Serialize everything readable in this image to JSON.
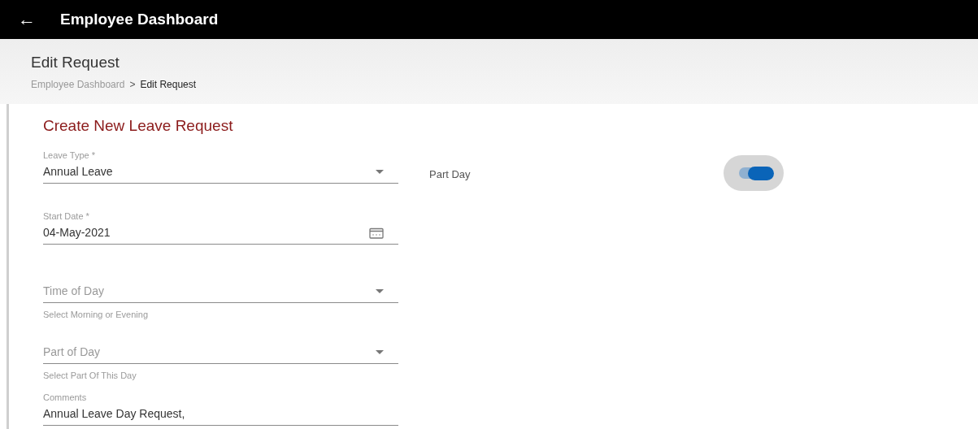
{
  "app_bar": {
    "back_icon": "←",
    "title": "Employee Dashboard"
  },
  "header": {
    "title": "Edit Request",
    "breadcrumb": [
      {
        "label": "Employee Dashboard",
        "current": false
      },
      {
        "label": "Edit Request",
        "current": true
      }
    ],
    "separator": ">"
  },
  "form": {
    "title": "Create New Leave Request",
    "fields": [
      {
        "kind": "select",
        "label": "Leave Type *",
        "value": "Annual Leave"
      },
      {
        "kind": "date",
        "label": "Start Date *",
        "value": "04-May-2021"
      },
      {
        "kind": "select",
        "placeholder": "Time of Day",
        "helper": "Select Morning or Evening"
      },
      {
        "kind": "select",
        "placeholder": "Part of Day",
        "helper": "Select Part Of This Day"
      },
      {
        "kind": "text",
        "label": "Comments",
        "value": "Annual Leave Day Request,"
      }
    ],
    "toggle": {
      "label": "Part Day",
      "on": true
    }
  }
}
